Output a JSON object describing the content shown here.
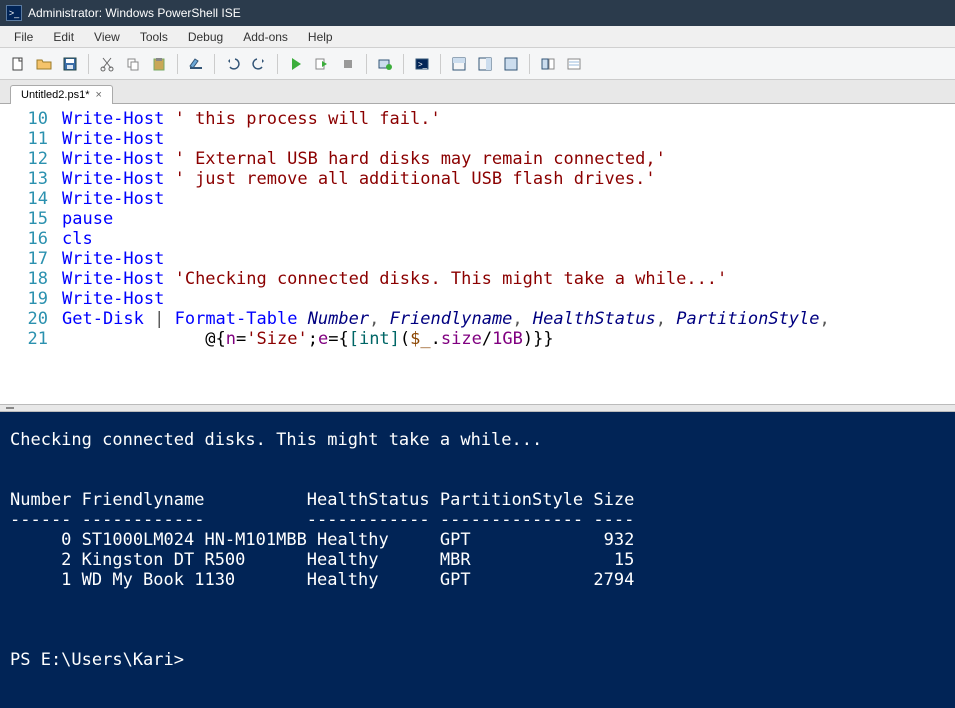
{
  "window": {
    "title": "Administrator: Windows PowerShell ISE",
    "app_icon_text": ">_"
  },
  "menu": {
    "file": "File",
    "edit": "Edit",
    "view": "View",
    "tools": "Tools",
    "debug": "Debug",
    "addons": "Add-ons",
    "help": "Help"
  },
  "tab": {
    "label": "Untitled2.ps1*",
    "close": "×"
  },
  "script": {
    "lines": [
      {
        "n": "10",
        "cmd": "Write-Host",
        "rest_type": "str",
        "rest": " ' this process will fail.'"
      },
      {
        "n": "11",
        "cmd": "Write-Host",
        "rest_type": "",
        "rest": ""
      },
      {
        "n": "12",
        "cmd": "Write-Host",
        "rest_type": "str",
        "rest": " ' External USB hard disks may remain connected,'"
      },
      {
        "n": "13",
        "cmd": "Write-Host",
        "rest_type": "str",
        "rest": " ' just remove all additional USB flash drives.'"
      },
      {
        "n": "14",
        "cmd": "Write-Host",
        "rest_type": "",
        "rest": ""
      },
      {
        "n": "15",
        "cmd": "pause",
        "rest_type": "",
        "rest": ""
      },
      {
        "n": "16",
        "cmd": "cls",
        "rest_type": "",
        "rest": ""
      },
      {
        "n": "17",
        "cmd": "Write-Host",
        "rest_type": "",
        "rest": ""
      },
      {
        "n": "18",
        "cmd": "Write-Host",
        "rest_type": "str",
        "rest": " 'Checking connected disks. This might take a while...'"
      },
      {
        "n": "19",
        "cmd": "Write-Host",
        "rest_type": "",
        "rest": ""
      }
    ],
    "line20": {
      "n": "20",
      "cmd": "Get-Disk",
      "pipe": " | ",
      "cmd2": "Format-Table",
      "params": [
        "Number",
        "Friendlyname",
        "HealthStatus",
        "PartitionStyle"
      ]
    },
    "line21": {
      "n": "21",
      "indent": "              ",
      "at": "@{",
      "n_lbl": "n",
      "eq1": "=",
      "n_val": "'Size'",
      "sep": ";",
      "e_lbl": "e",
      "eq2": "=",
      "ob": "{",
      "ot": "[",
      "type": "int",
      "ct": "]",
      "op": "(",
      "var": "$_",
      "dot": ".",
      "prop": "size",
      "div": "/",
      "unit": "1GB",
      "cp": ")",
      "cb": "}",
      "ce": "}"
    }
  },
  "console": {
    "msg": "Checking connected disks. This might take a while...",
    "hdr": "Number Friendlyname          HealthStatus PartitionStyle Size",
    "rule": "------ ------------          ------------ -------------- ----",
    "rows": [
      "     0 ST1000LM024 HN-M101MBB Healthy     GPT             932",
      "     2 Kingston DT R500      Healthy      MBR              15",
      "     1 WD My Book 1130       Healthy      GPT            2794"
    ],
    "prompt": "PS E:\\Users\\Kari> "
  }
}
